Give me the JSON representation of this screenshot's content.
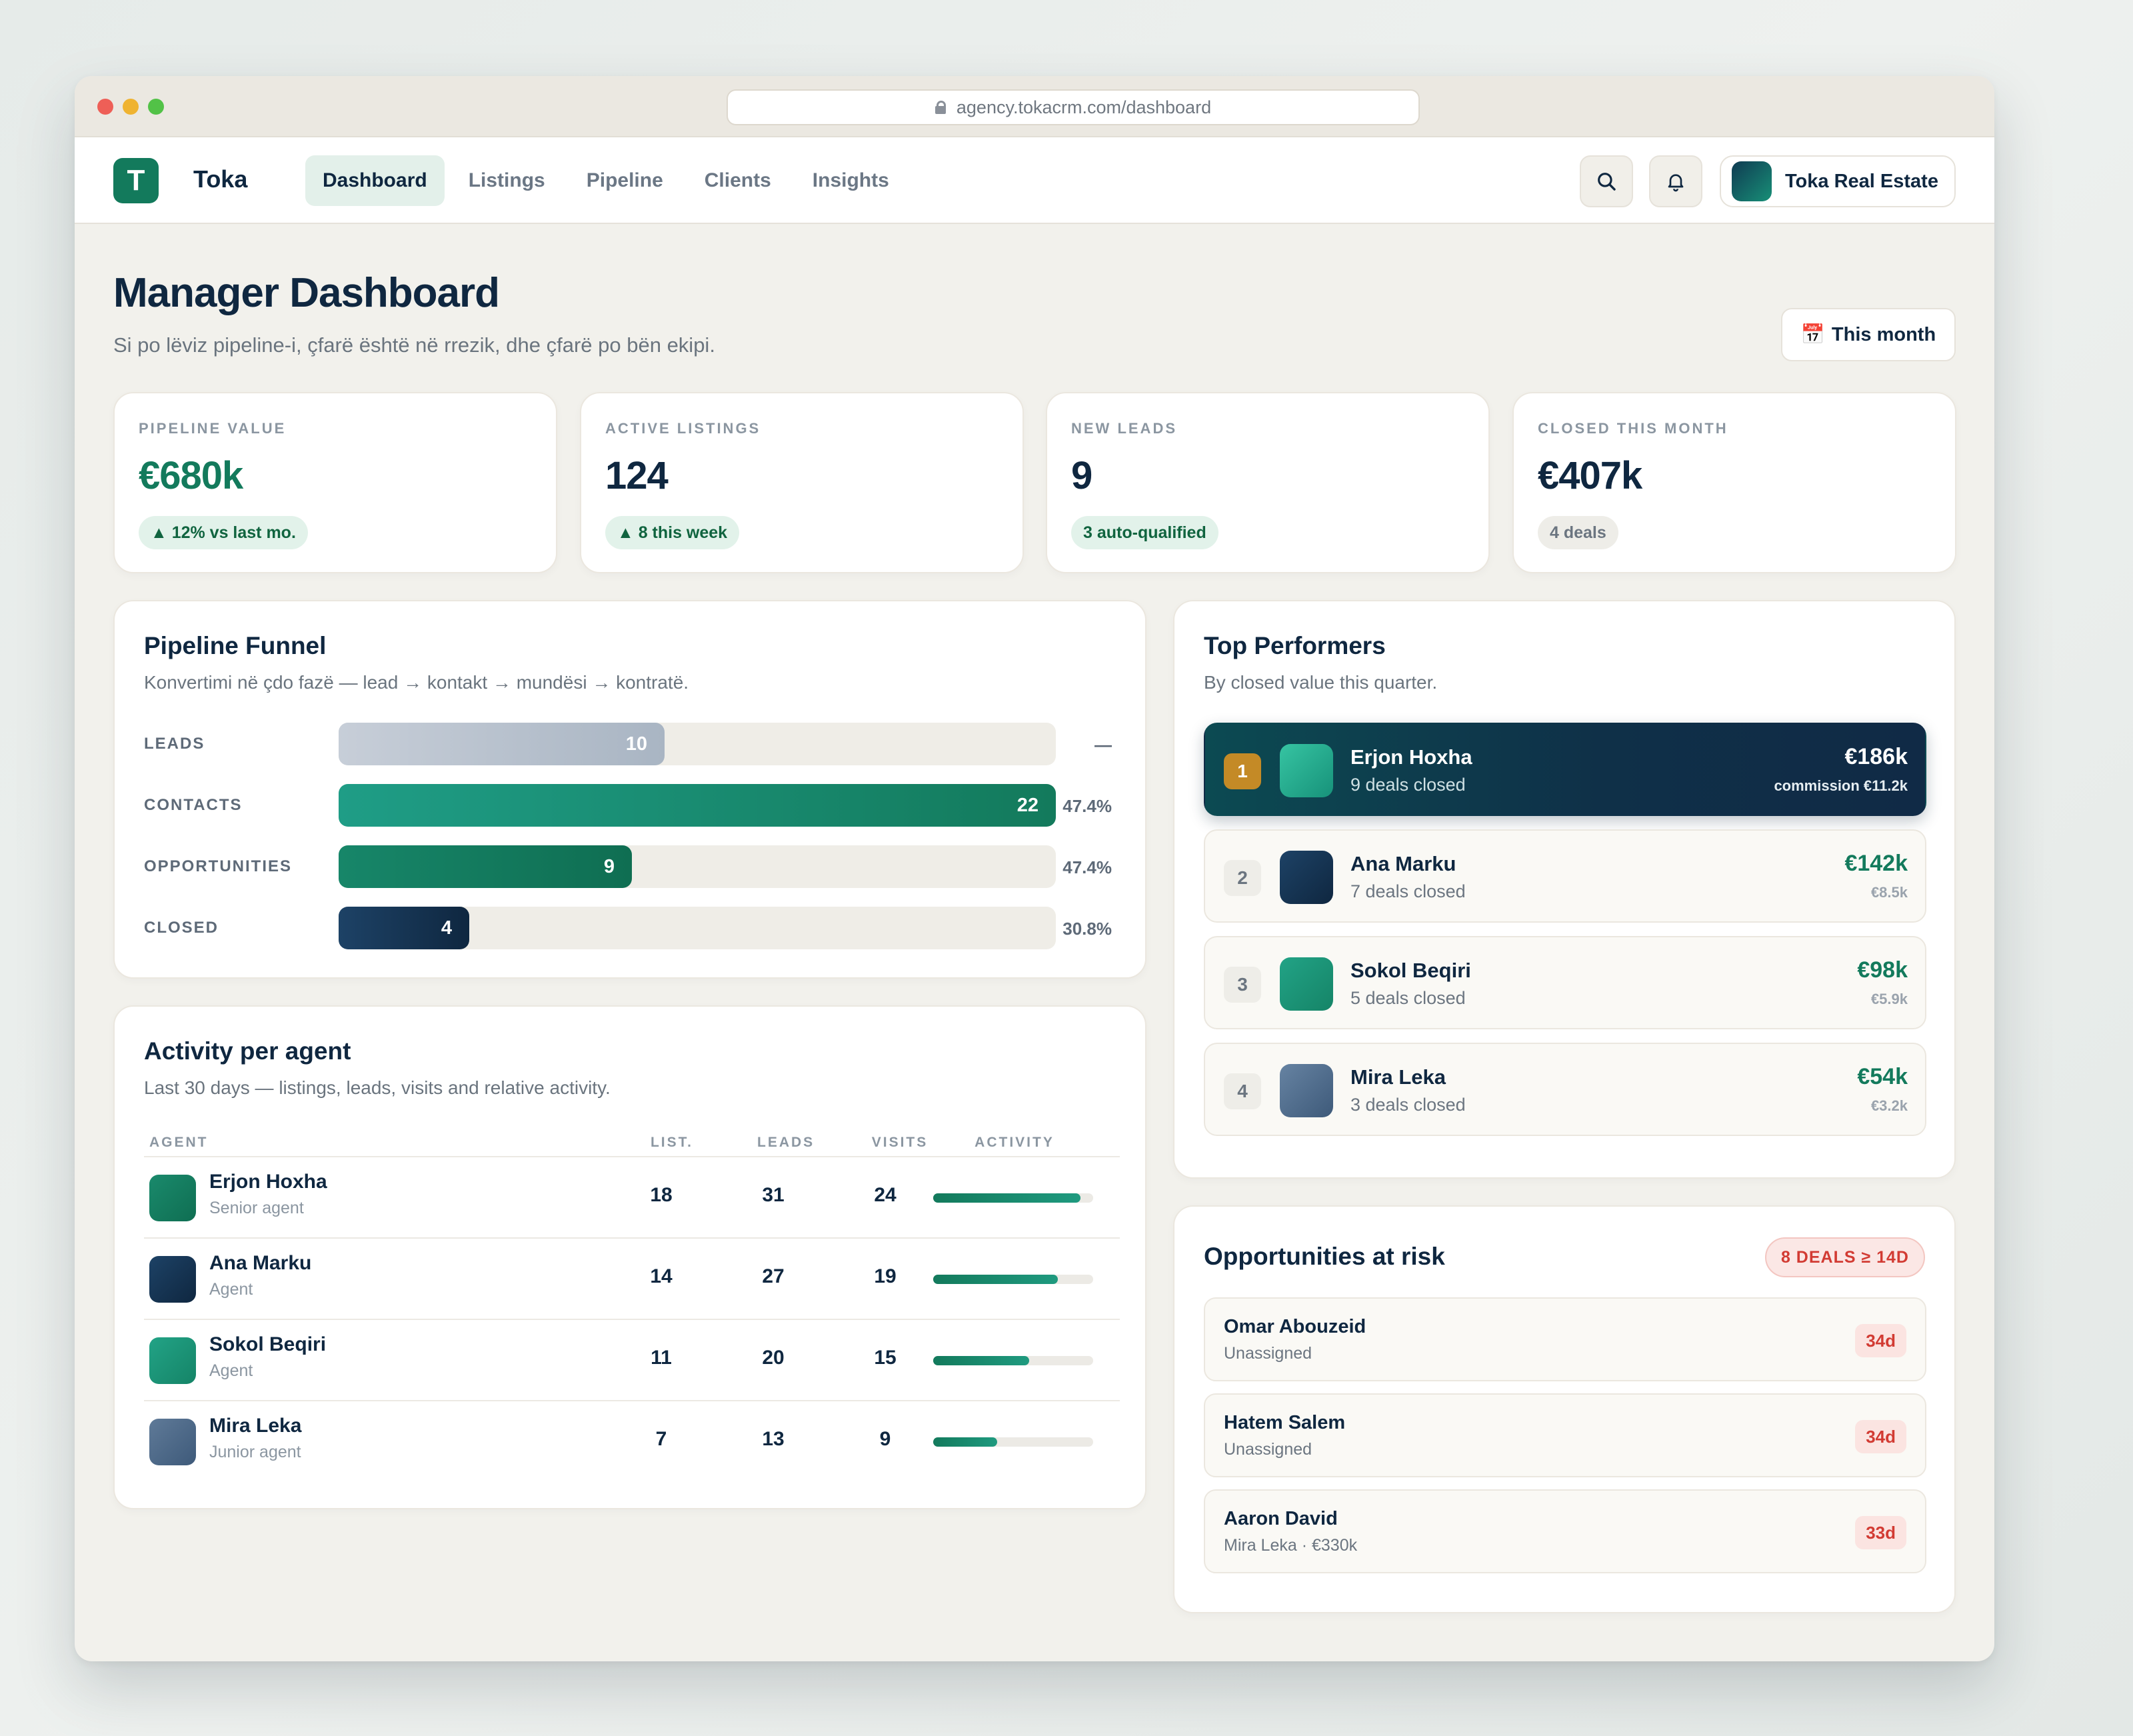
{
  "browser": {
    "url": "agency.tokacrm.com/dashboard"
  },
  "nav": {
    "logo_letter": "T",
    "brand": "Toka",
    "links": [
      "Dashboard",
      "Listings",
      "Pipeline",
      "Clients",
      "Insights"
    ],
    "active": "Dashboard",
    "org_name": "Toka Real Estate"
  },
  "header": {
    "title": "Manager Dashboard",
    "subtitle": "Si po lëviz pipeline-i, çfarë është në rrezik, dhe çfarë po bën ekipi.",
    "period_icon": "📅",
    "period_label": "This month"
  },
  "kpis": [
    {
      "label": "PIPELINE VALUE",
      "value": "€680k",
      "pill": "▲ 12% vs last mo.",
      "tone": "green"
    },
    {
      "label": "ACTIVE LISTINGS",
      "value": "124",
      "pill": "▲ 8 this week",
      "tone": "green"
    },
    {
      "label": "NEW LEADS",
      "value": "9",
      "pill": "3 auto-qualified",
      "tone": "green"
    },
    {
      "label": "CLOSED THIS MONTH",
      "value": "€407k",
      "pill": "4 deals",
      "tone": "gray"
    }
  ],
  "funnel": {
    "title": "Pipeline Funnel",
    "subtitle": "Konvertimi në çdo fazë — lead → kontakt → mundësi → kontratë.",
    "max": 22,
    "stages": [
      {
        "label": "LEADS",
        "value": 10,
        "value_label": "10",
        "rate": "—",
        "style": "gray"
      },
      {
        "label": "CONTACTS",
        "value": 22,
        "value_label": "22",
        "rate": "47.4%",
        "style": "teal"
      },
      {
        "label": "OPPORTUNITIES",
        "value": 9,
        "value_label": "9",
        "rate": "47.4%",
        "style": "green"
      },
      {
        "label": "CLOSED",
        "value": 4,
        "value_label": "4",
        "rate": "30.8%",
        "style": "navy"
      }
    ]
  },
  "activity": {
    "title": "Activity per agent",
    "subtitle": "Last 30 days — listings, leads, visits and relative activity.",
    "columns": [
      "AGENT",
      "LIST.",
      "LEADS",
      "VISITS",
      "ACTIVITY"
    ],
    "rows": [
      {
        "name": "Erjon Hoxha",
        "role": "Senior agent",
        "listings": "18",
        "leads": "31",
        "visits": "24",
        "activity": 0.92,
        "avatar": "green"
      },
      {
        "name": "Ana Marku",
        "role": "Agent",
        "listings": "14",
        "leads": "27",
        "visits": "19",
        "activity": 0.78,
        "avatar": "navy"
      },
      {
        "name": "Sokol Beqiri",
        "role": "Agent",
        "listings": "11",
        "leads": "20",
        "visits": "15",
        "activity": 0.6,
        "avatar": "teal"
      },
      {
        "name": "Mira Leka",
        "role": "Junior agent",
        "listings": "7",
        "leads": "13",
        "visits": "9",
        "activity": 0.4,
        "avatar": "slate"
      }
    ]
  },
  "performers": {
    "title": "Top Performers",
    "subtitle": "By closed value this quarter.",
    "items": [
      {
        "rank": "1",
        "name": "Erjon Hoxha",
        "deals": "9 deals closed",
        "value": "€186k",
        "commission": "commission €11.2k",
        "avatar": "teal-light"
      },
      {
        "rank": "2",
        "name": "Ana Marku",
        "deals": "7 deals closed",
        "value": "€142k",
        "commission": "€8.5k",
        "avatar": "navy"
      },
      {
        "rank": "3",
        "name": "Sokol Beqiri",
        "deals": "5 deals closed",
        "value": "€98k",
        "commission": "€5.9k",
        "avatar": "teal"
      },
      {
        "rank": "4",
        "name": "Mira Leka",
        "deals": "3 deals closed",
        "value": "€54k",
        "commission": "€3.2k",
        "avatar": "slate"
      }
    ]
  },
  "risk": {
    "title": "Opportunities at risk",
    "badge": "8 DEALS ≥ 14D",
    "items": [
      {
        "name": "Omar Abouzeid",
        "sub": "Unassigned",
        "days": "34d"
      },
      {
        "name": "Hatem Salem",
        "sub": "Unassigned",
        "days": "34d"
      },
      {
        "name": "Aaron David",
        "sub": "Mira Leka · €330k",
        "days": "33d"
      }
    ]
  },
  "colors": {
    "accent": "#137a5c",
    "navy": "#0f2740",
    "danger": "#d23b33",
    "background": "#f2f1ec"
  }
}
